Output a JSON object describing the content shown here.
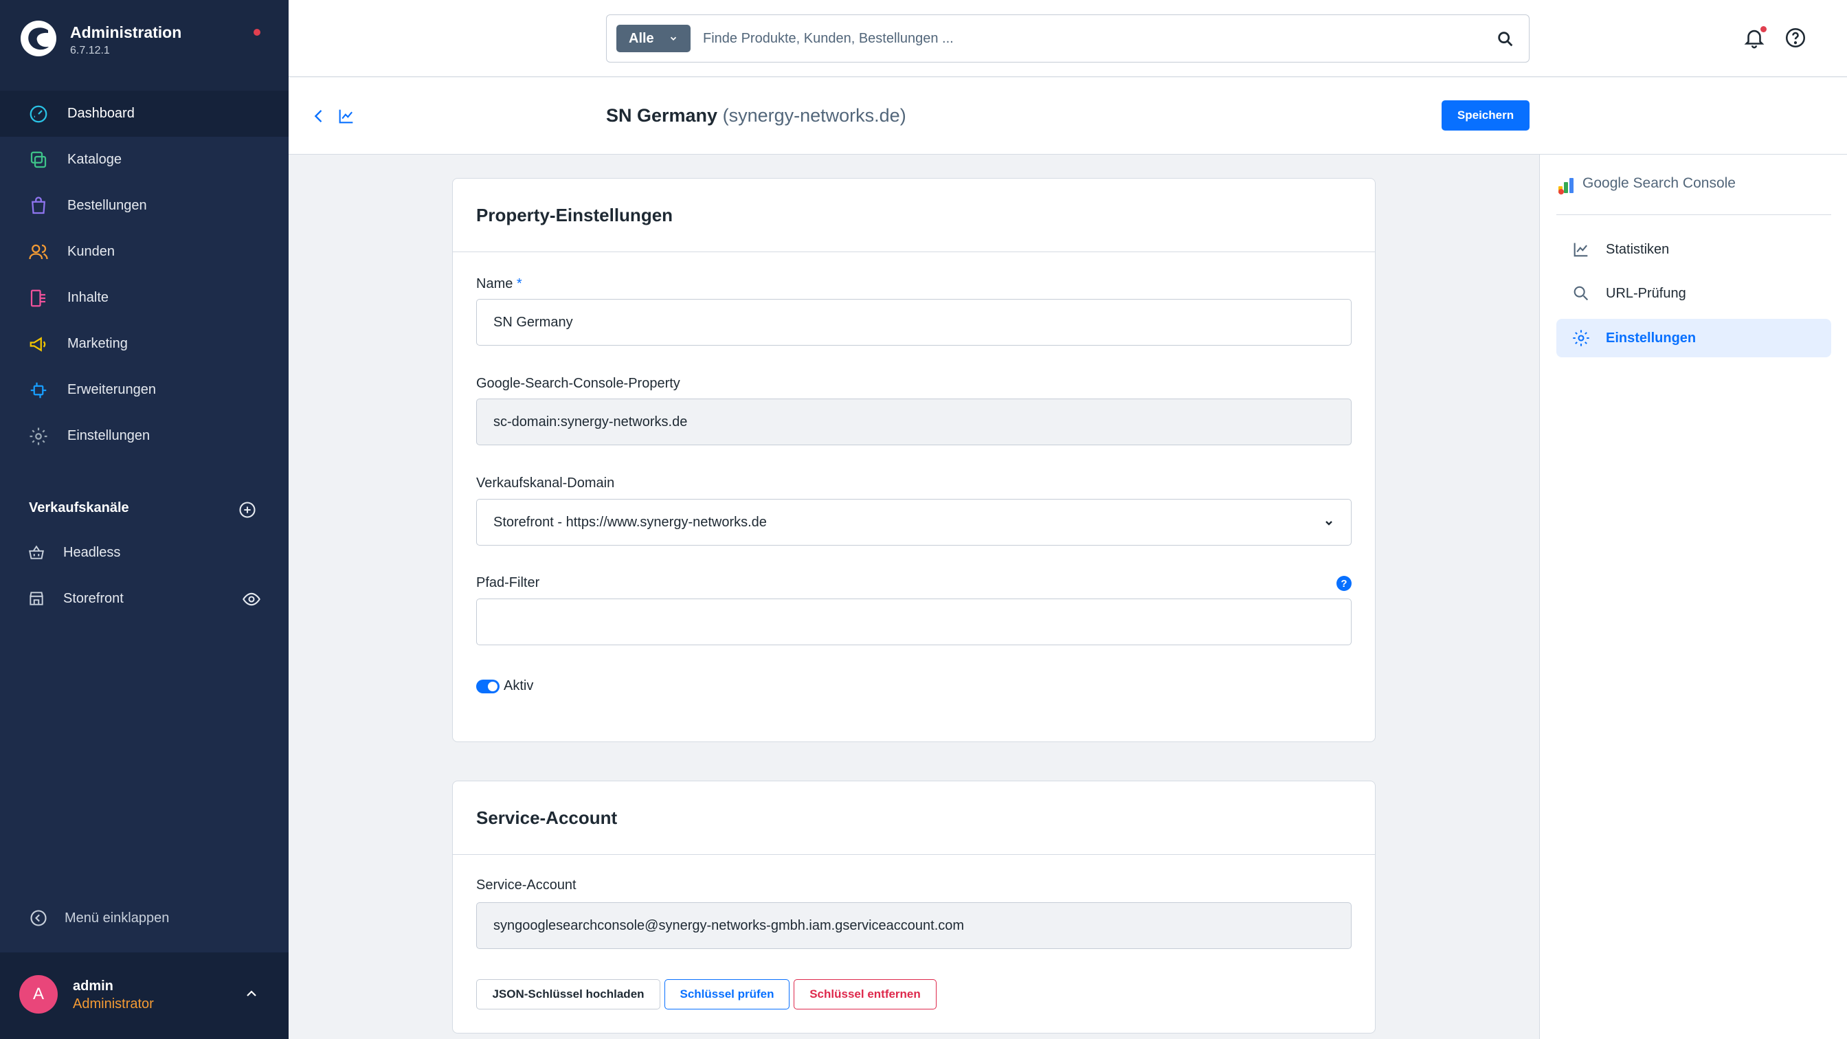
{
  "app": {
    "title": "Administration",
    "version": "6.7.12.1"
  },
  "nav": {
    "items": [
      {
        "label": "Dashboard",
        "icon": "dashboard-icon",
        "active": true
      },
      {
        "label": "Kataloge",
        "icon": "catalog-icon"
      },
      {
        "label": "Bestellungen",
        "icon": "orders-icon"
      },
      {
        "label": "Kunden",
        "icon": "customers-icon"
      },
      {
        "label": "Inhalte",
        "icon": "content-icon"
      },
      {
        "label": "Marketing",
        "icon": "marketing-icon"
      },
      {
        "label": "Erweiterungen",
        "icon": "extensions-icon"
      },
      {
        "label": "Einstellungen",
        "icon": "settings-icon"
      }
    ]
  },
  "sales_channels": {
    "title": "Verkaufskanäle",
    "items": [
      {
        "label": "Headless",
        "icon": "basket-icon"
      },
      {
        "label": "Storefront",
        "icon": "storefront-icon"
      }
    ]
  },
  "collapse_label": "Menü einklappen",
  "user": {
    "initial": "A",
    "name": "admin",
    "role": "Administrator"
  },
  "search": {
    "type_label": "Alle",
    "placeholder": "Finde Produkte, Kunden, Bestellungen ..."
  },
  "page": {
    "title_main": "SN Germany",
    "title_sub": "(synergy-networks.de)",
    "save_label": "Speichern"
  },
  "property_card": {
    "title": "Property-Einstellungen",
    "name_label": "Name",
    "name_required": "*",
    "name_value": "SN Germany",
    "property_label": "Google-Search-Console-Property",
    "property_value": "sc-domain:synergy-networks.de",
    "domain_label": "Verkaufskanal-Domain",
    "domain_value": "Storefront - https://www.synergy-networks.de",
    "path_label": "Pfad-Filter",
    "path_value": "",
    "help_glyph": "?",
    "active_label": "Aktiv",
    "active": true
  },
  "service_card": {
    "title": "Service-Account",
    "account_label": "Service-Account",
    "account_value": "syngooglesearchconsole@synergy-networks-gmbh.iam.gserviceaccount.com",
    "upload_label": "JSON-Schlüssel hochladen",
    "check_label": "Schlüssel prüfen",
    "remove_label": "Schlüssel entfernen"
  },
  "right_panel": {
    "title": "Google Search Console",
    "items": [
      {
        "label": "Statistiken",
        "icon": "chart-icon"
      },
      {
        "label": "URL-Prüfung",
        "icon": "search-icon"
      },
      {
        "label": "Einstellungen",
        "icon": "gear-icon",
        "active": true
      }
    ]
  },
  "colors": {
    "primary": "#0870ff",
    "sidebar": "#1d2c4a",
    "danger": "#de294c",
    "role": "#f49b34",
    "avatar": "#e9467a"
  }
}
